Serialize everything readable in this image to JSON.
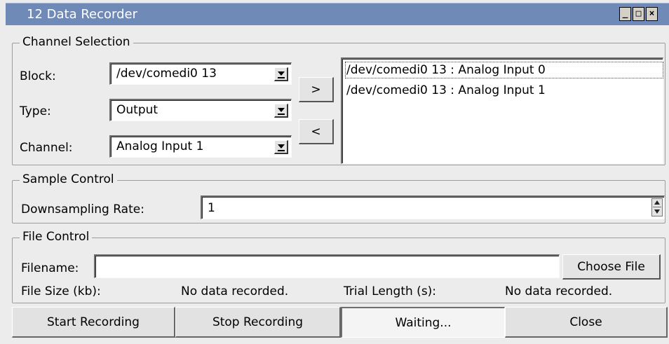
{
  "window": {
    "title": "12 Data Recorder",
    "minimize_glyph": "_",
    "maximize_glyph": "□",
    "close_glyph": "×"
  },
  "channel_selection": {
    "legend": "Channel Selection",
    "block_label": "Block:",
    "block_value": "/dev/comedi0 13",
    "type_label": "Type:",
    "type_value": "Output",
    "channel_label": "Channel:",
    "channel_value": "Analog Input 1",
    "add_button": ">",
    "remove_button": "<",
    "selected_channels": [
      "/dev/comedi0 13 : Analog Input 0",
      "/dev/comedi0 13 : Analog Input 1"
    ]
  },
  "sample_control": {
    "legend": "Sample Control",
    "rate_label": "Downsampling Rate:",
    "rate_value": "1"
  },
  "file_control": {
    "legend": "File Control",
    "filename_label": "Filename:",
    "filename_value": "",
    "choose_file_button": "Choose File",
    "file_size_label": "File Size (kb):",
    "file_size_value": "No data recorded.",
    "trial_length_label": "Trial Length (s):",
    "trial_length_value": "No data recorded."
  },
  "bottom_bar": {
    "start_button": "Start Recording",
    "stop_button": "Stop Recording",
    "status": "Waiting...",
    "close_button": "Close"
  },
  "colors": {
    "titlebar": "#6f8ab6",
    "window_bg": "#ececec"
  }
}
